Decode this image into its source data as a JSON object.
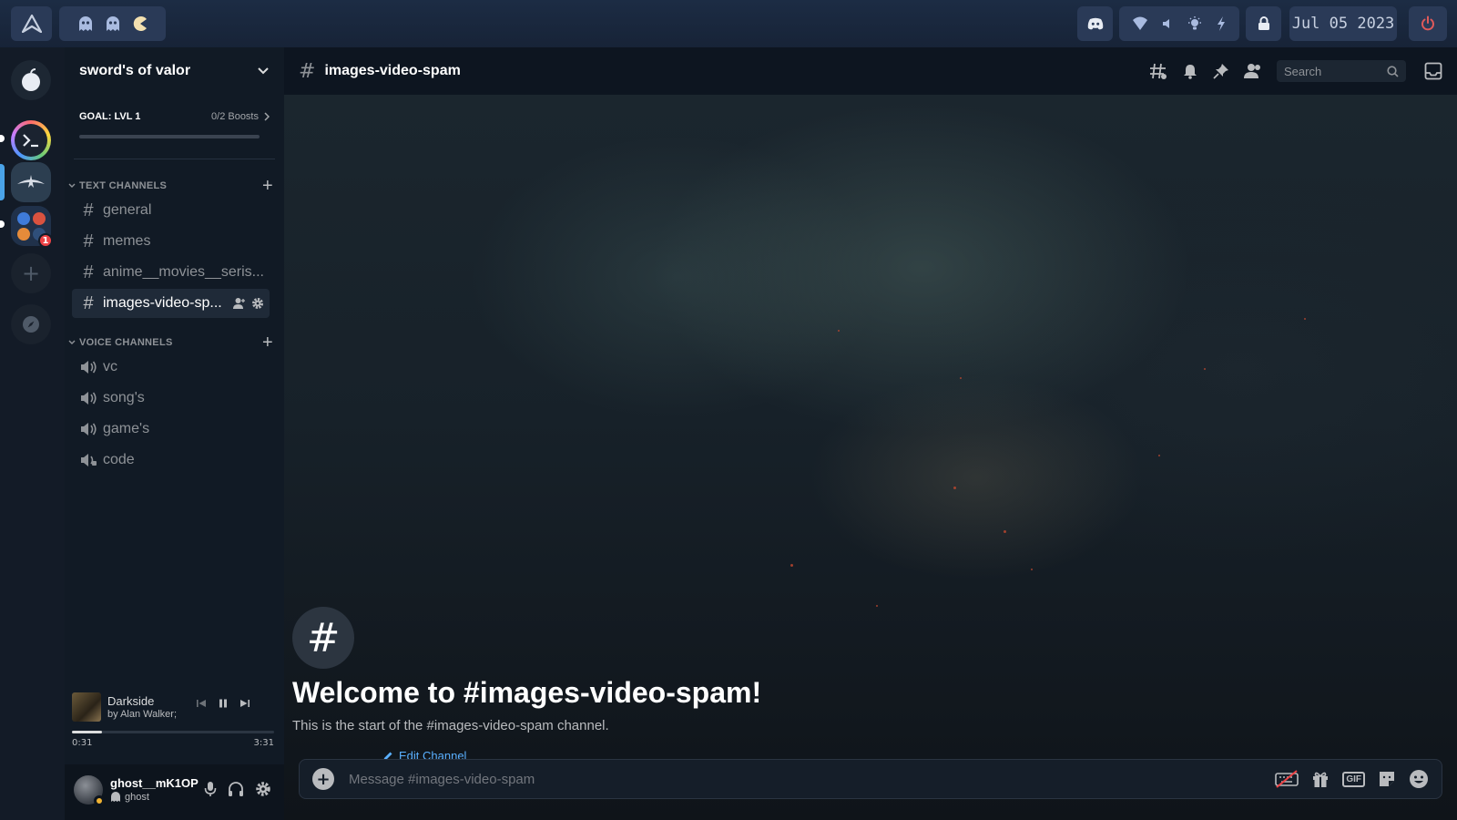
{
  "topbar": {
    "date": "Jul 05 2023"
  },
  "sidebar": {
    "server_name": "sword's of valor",
    "boost": {
      "goal": "GOAL: LVL 1",
      "count": "0/2 Boosts",
      "progress": 0
    },
    "text_category": "TEXT CHANNELS",
    "text_channels": [
      {
        "name": "general"
      },
      {
        "name": "memes"
      },
      {
        "name": "anime__movies__seris..."
      },
      {
        "name": "images-video-sp...",
        "active": true
      }
    ],
    "voice_category": "VOICE CHANNELS",
    "voice_channels": [
      {
        "name": "vc"
      },
      {
        "name": "song's"
      },
      {
        "name": "game's"
      },
      {
        "name": "code"
      }
    ],
    "player": {
      "title": "Darkside",
      "artist": "by Alan Walker;",
      "current": "0:31",
      "total": "3:31",
      "progress": 0.15
    },
    "user": {
      "name": "ghost__mK1OP",
      "status": "ghost"
    }
  },
  "rail": {
    "badge_count": "1"
  },
  "main": {
    "channel_title": "images-video-spam",
    "search_placeholder": "Search",
    "welcome_title": "Welcome to #images-video-spam!",
    "welcome_sub": "This is the start of the #images-video-spam channel.",
    "edit_channel": "Edit Channel",
    "composer_placeholder": "Message #images-video-spam",
    "gif_label": "GIF"
  },
  "colors": {
    "accent": "#4aa3e8",
    "link": "#5ab0ff",
    "danger": "#ed4245",
    "power": "#e05a5a"
  }
}
